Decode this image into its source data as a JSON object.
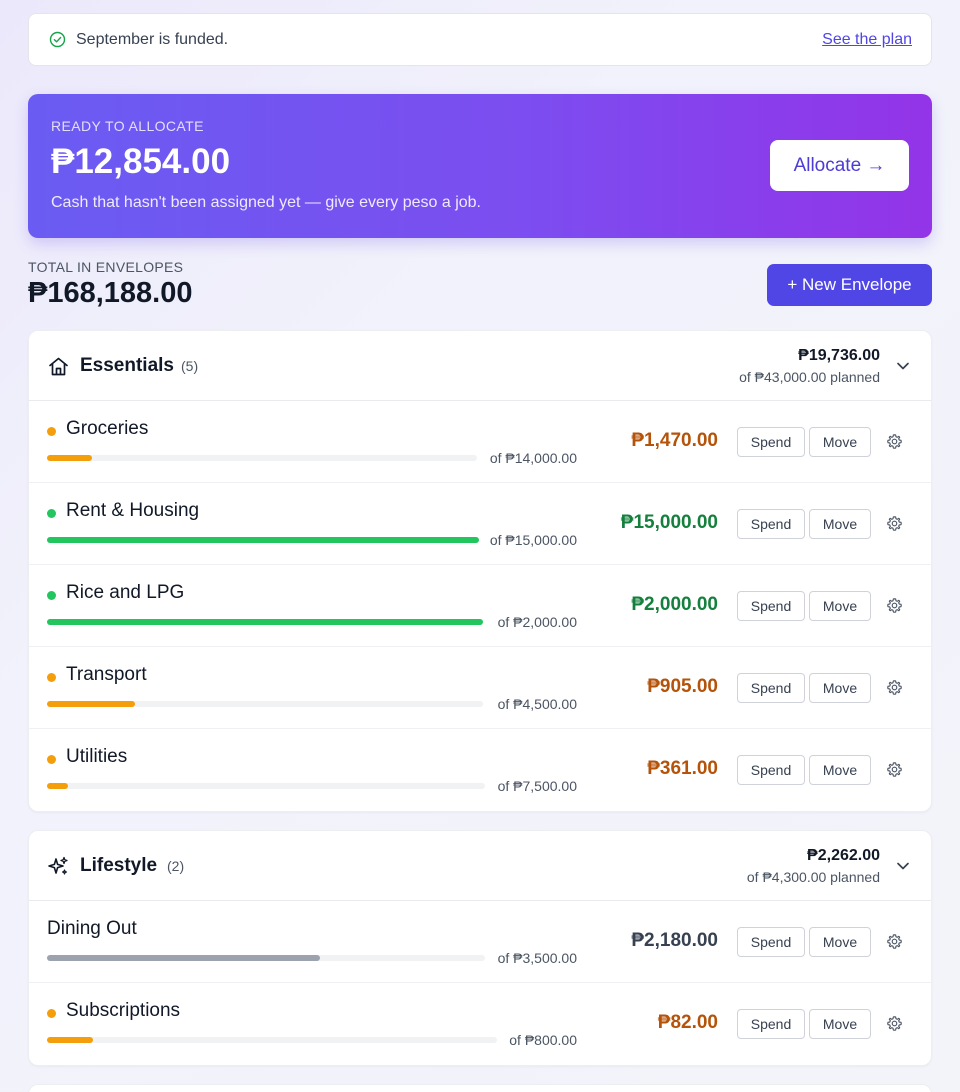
{
  "banner": {
    "message": "September is funded.",
    "link": "See the plan"
  },
  "hero": {
    "caption": "READY TO ALLOCATE",
    "amount": "₱12,854.00",
    "subtitle": "Cash that hasn't been assigned yet — give every peso a job.",
    "button": "Allocate →"
  },
  "totals": {
    "caption": "TOTAL IN ENVELOPES",
    "amount": "₱168,188.00",
    "new_button": "+ New Envelope"
  },
  "colors": {
    "accent": "#4f46e5",
    "ok_dot": "#22c55e",
    "warn_dot": "#f59e0b",
    "neutral_bar": "#9ca3af",
    "amount_ok": "#15803d",
    "amount_warn": "#b45309",
    "amount_neutral": "#374151"
  },
  "groups": [
    {
      "icon": "home-icon",
      "name": "Essentials",
      "count": "(5)",
      "total": "₱19,736.00",
      "planned": "of ₱43,000.00 planned",
      "envelopes": [
        {
          "name": "Groceries",
          "status": "warn",
          "progress": 0.105,
          "of": "of ₱14,000.00",
          "amount": "₱1,470.00",
          "spend": "Spend",
          "move": "Move"
        },
        {
          "name": "Rent & Housing",
          "status": "ok",
          "progress": 1.0,
          "of": "of ₱15,000.00",
          "amount": "₱15,000.00",
          "spend": "Spend",
          "move": "Move"
        },
        {
          "name": "Rice and LPG",
          "status": "ok",
          "progress": 1.0,
          "of": "of ₱2,000.00",
          "amount": "₱2,000.00",
          "spend": "Spend",
          "move": "Move"
        },
        {
          "name": "Transport",
          "status": "warn",
          "progress": 0.201,
          "of": "of ₱4,500.00",
          "amount": "₱905.00",
          "spend": "Spend",
          "move": "Move"
        },
        {
          "name": "Utilities",
          "status": "warn",
          "progress": 0.048,
          "of": "of ₱7,500.00",
          "amount": "₱361.00",
          "spend": "Spend",
          "move": "Move"
        }
      ]
    },
    {
      "icon": "sparkles-icon",
      "name": "Lifestyle",
      "count": "(2)",
      "total": "₱2,262.00",
      "planned": "of ₱4,300.00 planned",
      "envelopes": [
        {
          "name": "Dining Out",
          "status": "neutral",
          "progress": 0.623,
          "of": "of ₱3,500.00",
          "amount": "₱2,180.00",
          "spend": "Spend",
          "move": "Move"
        },
        {
          "name": "Subscriptions",
          "status": "warn",
          "progress": 0.103,
          "of": "of ₱800.00",
          "amount": "₱82.00",
          "spend": "Spend",
          "move": "Move"
        }
      ]
    }
  ]
}
